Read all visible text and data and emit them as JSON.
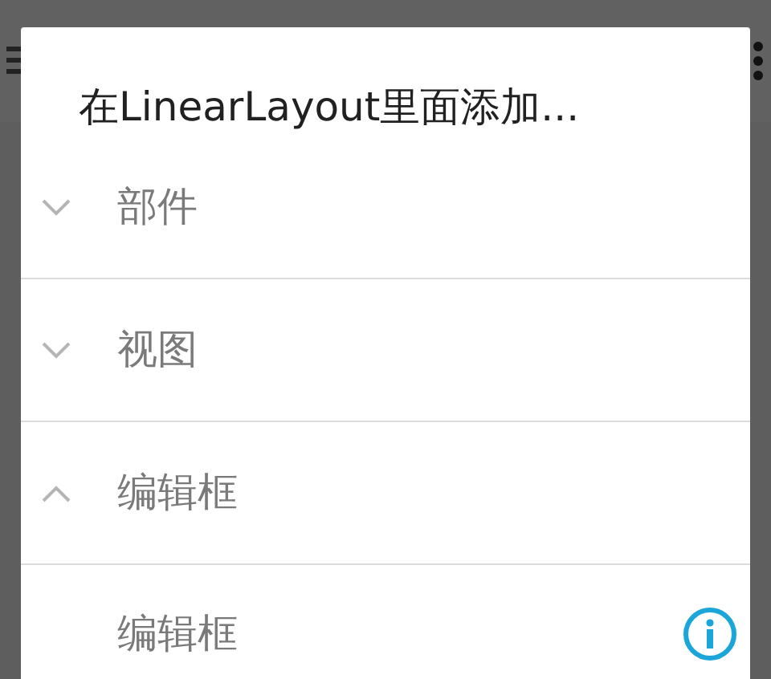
{
  "dialog": {
    "title": "在LinearLayout里面添加...",
    "groups": [
      {
        "label": "部件",
        "expanded": false
      },
      {
        "label": "视图",
        "expanded": false
      },
      {
        "label": "编辑框",
        "expanded": true,
        "children": [
          {
            "label": "编辑框"
          }
        ]
      }
    ]
  }
}
